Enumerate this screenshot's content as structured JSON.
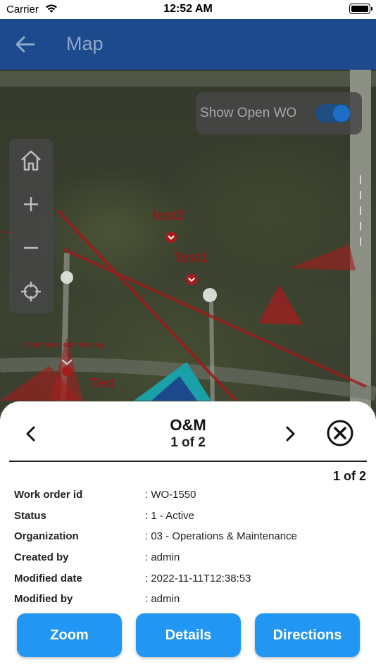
{
  "status_bar": {
    "carrier": "Carrier",
    "time": "12:52 AM"
  },
  "app_bar": {
    "title": "Map"
  },
  "map": {
    "toggle_label": "Show Open WO",
    "toggle_on": true,
    "labels": {
      "test2": "test2",
      "test1": "Test1",
      "confusion": "Confusion stat testing",
      "test": "Test"
    }
  },
  "sheet": {
    "title": "O&M",
    "pager": "1 of 2",
    "pager_right": "1 of 2",
    "rows": [
      {
        "key": "Work order id",
        "value": ": WO-1550"
      },
      {
        "key": "Status",
        "value": ": 1 - Active"
      },
      {
        "key": "Organization",
        "value": ": 03 - Operations & Maintenance"
      },
      {
        "key": "Created by",
        "value": ": admin"
      },
      {
        "key": "Modified date",
        "value": ": 2022-11-11T12:38:53"
      },
      {
        "key": "Modified by",
        "value": ": admin"
      }
    ],
    "buttons": {
      "zoom": "Zoom",
      "details": "Details",
      "directions": "Directions"
    }
  },
  "colors": {
    "app_bar": "#1c4a8c",
    "button": "#2196f3",
    "marker": "#a51d1d",
    "toggle": "#1b6fc9"
  }
}
